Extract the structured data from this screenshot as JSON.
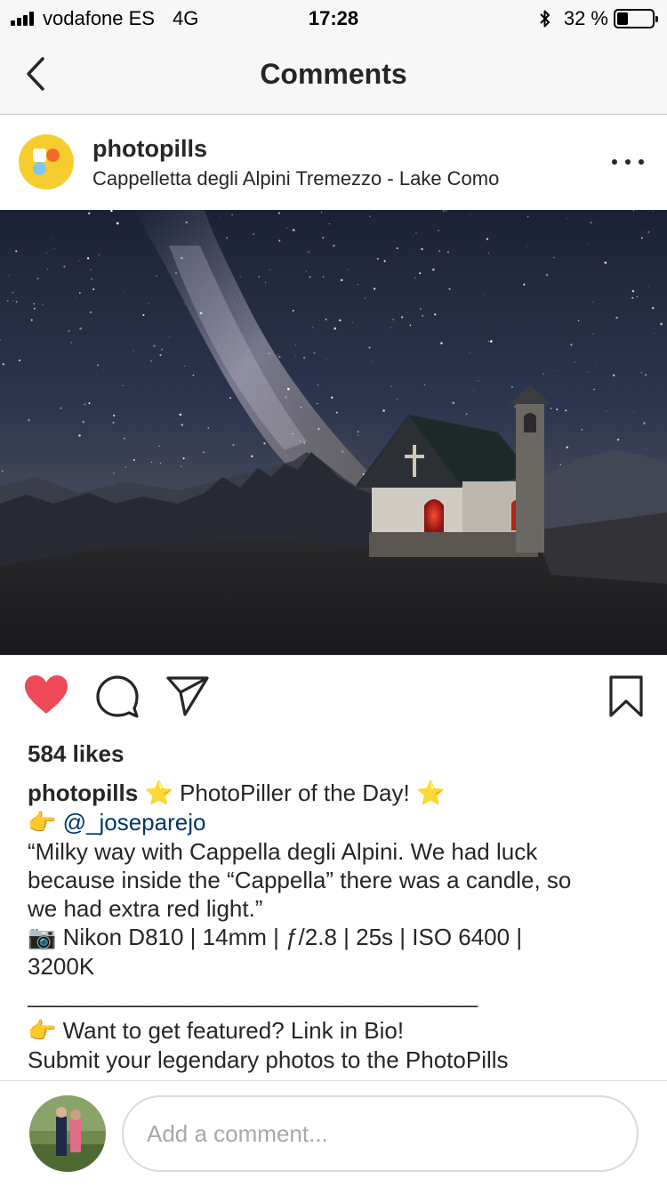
{
  "status_bar": {
    "carrier": "vodafone ES",
    "network": "4G",
    "time": "17:28",
    "battery_percent": "32 %",
    "battery_level": 0.32,
    "icons": [
      "signal-icon",
      "bluetooth-icon",
      "battery-icon"
    ]
  },
  "nav": {
    "title": "Comments",
    "back_icon": "chevron-left-icon"
  },
  "post": {
    "username": "photopills",
    "location": "Cappelletta degli Alpini Tremezzo - Lake Como",
    "more_icon": "ellipsis-icon",
    "likes": "584 likes",
    "liked": true,
    "accent_color": "#ed4956"
  },
  "caption": {
    "username": "photopills",
    "title": "PhotoPiller of the Day!",
    "star": "⭐",
    "hand": "👉",
    "camera": "📷",
    "mention": "@_joseparejo",
    "quote_line1": "“Milky way with Cappella degli Alpini. We had luck",
    "quote_line2": "because inside the “Cappella” there was a candle, so",
    "quote_line3": "we had extra red light.”",
    "specs_line1": "Nikon D810 | 14mm | ƒ/2.8 | 25s | ISO 6400 |",
    "specs_line2": "3200K",
    "divider": "___________________________________",
    "featured": "Want to get featured? Link in Bio!",
    "submit": "Submit your legendary photos to the PhotoPills"
  },
  "comment_box": {
    "placeholder": "Add a comment..."
  }
}
